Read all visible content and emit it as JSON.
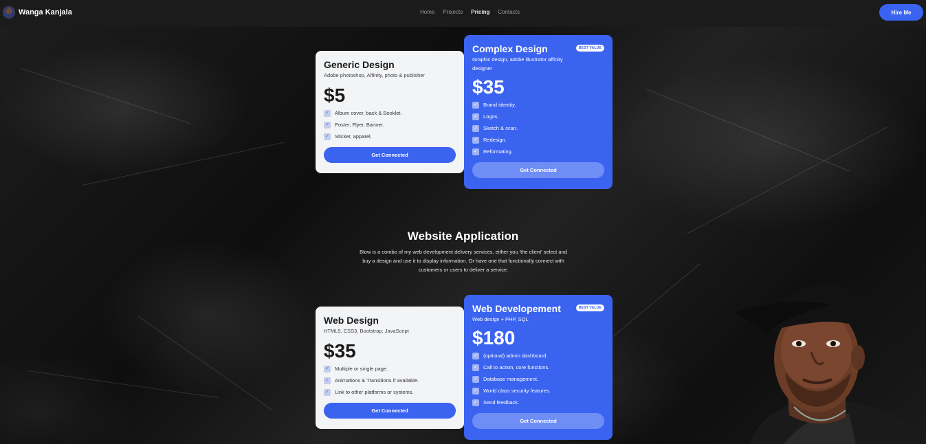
{
  "nav": {
    "brand": "Wanga Kanjala",
    "links": [
      "Home",
      "Projects",
      "Pricing",
      "Contacts"
    ],
    "active": "Pricing",
    "hire_label": "Hire Me"
  },
  "graphic_cards": [
    {
      "title": "Generic Design",
      "subtitle": "Adobe photoshop, Affinity, photo & publisher",
      "price": "$5",
      "features": [
        "Album cover, back & Booklet.",
        "Poster, Flyer, Banner.",
        "Sticker, apparel."
      ],
      "button": "Get Connected"
    },
    {
      "title": "Complex Design",
      "badge": "BEST VALUE",
      "subtitle": "Graphic design, adobe illustrator affinity designer",
      "price": "$35",
      "features": [
        "Brand identity.",
        "Logos.",
        "Sketch & scan.",
        "Redesign.",
        "Reformating."
      ],
      "button": "Get Connected"
    }
  ],
  "section": {
    "title": "Website Application",
    "description": "Blow is a combo of my web development delivery services, either you 'the client' select and buy a design and use it to display information. Or have one that functionally connect with customers or users to deliver a service."
  },
  "web_cards": [
    {
      "title": "Web Design",
      "subtitle": "HTML5, CSS3, Bootstrap, JavaScript",
      "price": "$35",
      "features": [
        "Multiple or single page.",
        "Animations & Transitions if available.",
        "Link to other platforms or systems."
      ],
      "button": "Get Connected"
    },
    {
      "title": "Web Developement",
      "badge": "BEST VALUE",
      "subtitle": "Web design + PHP, SQL",
      "price": "$180",
      "features": [
        "(optional) admin dashboard.",
        "Call to action, core functions.",
        "Database management.",
        "World class security features.",
        "Send feedback."
      ],
      "button": "Get Connected"
    }
  ],
  "icons": {
    "check": "check-icon"
  },
  "colors": {
    "accent": "#3a63f0",
    "nav_bg": "#1b1b1b",
    "card_light": "#f3f4f6"
  }
}
